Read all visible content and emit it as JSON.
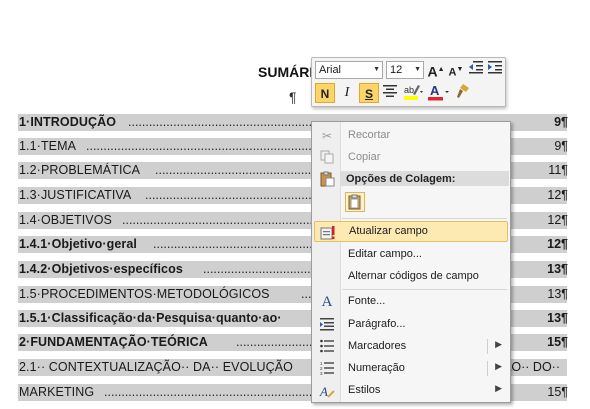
{
  "document": {
    "heading": "SUMÁRI",
    "pilcrow": "¶",
    "toc": [
      {
        "text": "1·INTRODUÇÃO",
        "page": "9¶",
        "bold": true
      },
      {
        "text": "1.1·TEMA",
        "page": "9¶",
        "bold": false
      },
      {
        "text": "1.2·PROBLEMÁTICA",
        "page": "11¶",
        "bold": false
      },
      {
        "text": "1.3·JUSTIFICATIVA",
        "page": "12¶",
        "bold": false
      },
      {
        "text": "1.4·OBJETIVOS",
        "page": "12¶",
        "bold": false
      },
      {
        "text": "1.4.1·Objetivo·geral",
        "page": "12¶",
        "bold": true
      },
      {
        "text": "1.4.2·Objetivos·específicos",
        "page": "13¶",
        "bold": true
      },
      {
        "text": "1.5·PROCEDIMENTOS·METODOLÓGICOS",
        "page": "13¶",
        "bold": false
      },
      {
        "text": "1.5.1·Classificação·da·Pesquisa·quanto·ao·",
        "page": "13¶",
        "bold": true
      },
      {
        "text": "2·FUNDAMENTAÇÃO·TEÓRICA",
        "page": "15¶",
        "bold": true
      },
      {
        "text": "2.1·· CONTEXTUALIZAÇÃO·· DA·· EVOLUÇÃO",
        "page": "ÃO·· DO··",
        "bold": false
      },
      {
        "text": "MARKETING",
        "page": "15¶",
        "bold": false
      }
    ]
  },
  "mini_toolbar": {
    "font": "Arial",
    "size": "12",
    "grow_font": "A",
    "shrink_font": "A",
    "bold": "N",
    "italic": "I",
    "strike": "S"
  },
  "context_menu": {
    "items": [
      {
        "label": "Recortar",
        "icon": "scissors-icon",
        "disabled": true
      },
      {
        "label": "Copiar",
        "icon": "copy-icon",
        "disabled": true
      },
      {
        "label": "Opções de Colagem:",
        "icon": "paste-icon",
        "section": true
      },
      {
        "label": "Atualizar campo",
        "icon": "update-field-icon",
        "highlighted": true
      },
      {
        "label": "Editar campo...",
        "icon": ""
      },
      {
        "label": "Alternar códigos de campo",
        "icon": ""
      },
      {
        "label": "Fonte...",
        "icon": "font-icon"
      },
      {
        "label": "Parágrafo...",
        "icon": "paragraph-icon"
      },
      {
        "label": "Marcadores",
        "icon": "bullets-icon",
        "submenu": true
      },
      {
        "label": "Numeração",
        "icon": "numbering-icon",
        "submenu": true
      },
      {
        "label": "Estilos",
        "icon": "styles-icon",
        "submenu": true
      }
    ]
  },
  "colors": {
    "highlight": "#cfcfcf",
    "menu_hover": "#fdeab3",
    "toolbar_active": "#fbd56a"
  }
}
